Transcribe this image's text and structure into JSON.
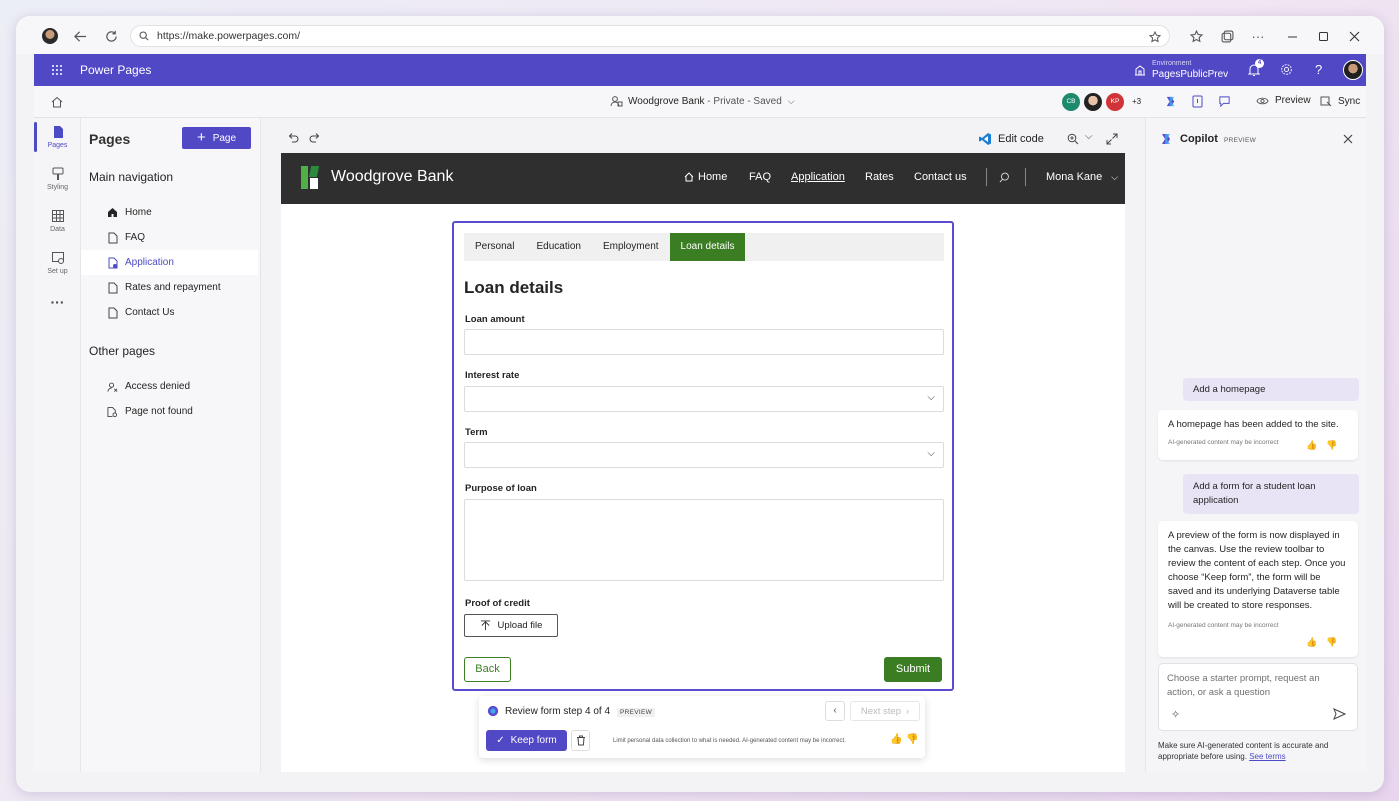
{
  "browser": {
    "url": "https://make.powerpages.com/"
  },
  "app": {
    "title": "Power Pages",
    "env_label": "Environment",
    "env_name": "PagesPublicPrev",
    "notif_count": "4"
  },
  "toolbar": {
    "site_name": "Woodgrove Bank",
    "site_status": " - Private - Saved",
    "avatars": [
      "CB",
      "",
      "KP"
    ],
    "more_users": "+3",
    "preview": "Preview",
    "sync": "Sync"
  },
  "rail": {
    "items": [
      "Pages",
      "Styling",
      "Data",
      "Set up"
    ]
  },
  "pages_panel": {
    "title": "Pages",
    "add_page": "Page",
    "main_nav_heading": "Main navigation",
    "main_nav": [
      "Home",
      "FAQ",
      "Application",
      "Rates and repayment",
      "Contact Us"
    ],
    "other_heading": "Other pages",
    "other": [
      "Access denied",
      "Page not found"
    ]
  },
  "canvas_toolbar": {
    "edit_code": "Edit code"
  },
  "site": {
    "brand": "Woodgrove Bank",
    "nav": [
      "Home",
      "FAQ",
      "Application",
      "Rates",
      "Contact us"
    ],
    "user": "Mona Kane"
  },
  "form": {
    "tabs": [
      "Personal",
      "Education",
      "Employment",
      "Loan details"
    ],
    "heading": "Loan details",
    "labels": {
      "loan_amount": "Loan amount",
      "interest_rate": "Interest rate",
      "term": "Term",
      "purpose": "Purpose of loan",
      "proof": "Proof of credit"
    },
    "upload": "Upload file",
    "back": "Back",
    "submit": "Submit"
  },
  "review": {
    "title": "Review form step 4 of 4",
    "badge": "PREVIEW",
    "next_step": "Next step",
    "keep": "Keep form",
    "note": "Limit personal data collection to what is needed. AI-generated content may be incorrect."
  },
  "copilot": {
    "title": "Copilot",
    "badge": "PREVIEW",
    "user1": "Add a homepage",
    "ai1": "A homepage has been added to the site.",
    "disclaimer": "AI-generated content may be incorrect",
    "user2": "Add a form for a student loan application",
    "ai2": "A preview of the form is now displayed in the canvas. Use the review toolbar to review the content of each step. Once you choose “Keep form”, the form will be saved and its underlying Dataverse table will be created to store responses.",
    "input_placeholder": "Choose a starter prompt, request an action, or ask a question",
    "footer": "Make sure AI-generated content is accurate and appropriate before using.",
    "see_terms": "See terms"
  },
  "colors": {
    "brand": "#5148c6",
    "green": "#3b7d23",
    "dark_header": "#2f2f2f"
  },
  "icons": [
    "back-icon",
    "refresh-icon",
    "lock-icon",
    "favorites-icon",
    "collections-icon",
    "more-icon",
    "minimize-icon",
    "maximize-icon",
    "close-icon",
    "waffle-icon",
    "bell-icon",
    "gear-icon",
    "help-icon",
    "home-icon",
    "undo-icon",
    "redo-icon",
    "vscode-icon",
    "zoom-icon",
    "expand-icon",
    "search-icon",
    "upload-icon",
    "trash-icon",
    "thumb-up-icon",
    "thumb-down-icon",
    "send-icon",
    "sparkle-icon",
    "copilot-icon"
  ]
}
